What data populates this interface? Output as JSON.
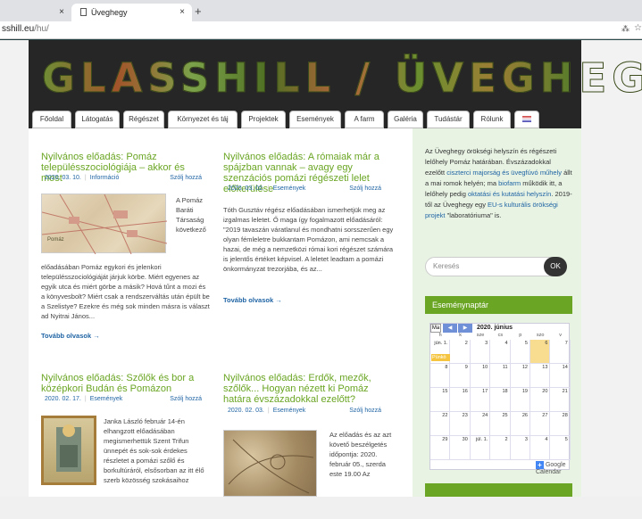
{
  "browser": {
    "tab1_close": "×",
    "tab2_title": "Üveghegy",
    "tab2_close": "×",
    "new_tab": "+",
    "url_host": "sshill.eu",
    "url_path": "/hu/",
    "translate_icon": "translate-icon",
    "star_icon": "star-icon"
  },
  "site": {
    "logo": "GLASSHILL / ÜVEGHEGY",
    "nav": [
      "Főoldal",
      "Látogatás",
      "Régészet",
      "Környezet és táj",
      "Projektek",
      "Események",
      "A farm",
      "Galéria",
      "Tudástár",
      "Rólunk"
    ],
    "nav_flag": "uk-flag-icon"
  },
  "posts": [
    {
      "title": "Nyilvános előadás: Pomáz településszociológiája – akkor és most",
      "date": "2020. 03. 10.",
      "category": "Információ",
      "reply": "Szólj hozzá",
      "side_text": "A Pomáz Baráti Társaság következő",
      "body": "előadásában Pomáz egykori és jelenkori településszociológiáját járjuk körbe. Miért egyenes az egyik utca és miért görbe a másik? Hová tűnt a mozi és a könyvesbolt? Miért csak a rendszerváltás után épült be a Szelistye? Ezekre és még sok minden másra is választ ad Nyitrai János...",
      "more": "Tovább olvasok →",
      "map_label": "Pomáz"
    },
    {
      "title": "Nyilvános előadás: A rómaiak már a spájzban vannak – avagy egy szenzációs pomázi régészeti lelet előkerülése",
      "date": "2020. 03. 02.",
      "category": "Események",
      "reply": "Szólj hozzá",
      "body": "Tóth Gusztáv régész előadásában ismerhetjük meg az izgalmas leletet. Ő maga így fogalmazott előadásáról: \"2019 tavaszán váratlanul és mondhatni sorsszerűen egy olyan fémleletre bukkantam Pomázon, ami nemcsak a hazai, de még a nemzetközi római kori régészet számára is jelentős értéket képvisel. A leletet leadtam a pomázi önkormányzat trezorjába, és az...",
      "more": "Tovább olvasok →"
    },
    {
      "title": "Nyilvános előadás: Szőlők és bor a középkori Budán és Pomázon",
      "date": "2020. 02. 17.",
      "category": "Események",
      "reply": "Szólj hozzá",
      "side_text": "Janka László február 14-én elhangzott előadásában megismerhettük Szent Trifun ünnepét és sok-sok érdekes részletet a pomázi szőlő és borkultúráról, elsősorban az itt élő szerb közösség szokásaihoz"
    },
    {
      "title": "Nyilvános előadás: Erdők, mezők, szőlők... Hogyan nézett ki Pomáz határa évszázadokkal ezelőtt?",
      "date": "2020. 02. 03.",
      "category": "Események",
      "reply": "Szólj hozzá",
      "side_text": "Az előadás és az azt követő beszélgetés időpontja: 2020. február 05., szerda este 19.00 Az"
    }
  ],
  "sidebar": {
    "intro_1": "Az Üveghegy örökségi helyszín és régészeti lelőhely Pomáz határában. Évszázadokkal ezelőtt ",
    "intro_link1": "ciszterci majorság és üvegfúvó műhely",
    "intro_2": " állt a mai romok helyén; ma ",
    "intro_link2": "biofarm",
    "intro_3": " működik itt, a lelőhely pedig ",
    "intro_link3": "oktatási és kutatási helyszín",
    "intro_4": ". 2019-től az Üveghegy egy ",
    "intro_link4": "EU-s kulturális örökségi projekt",
    "intro_5": " \"laboratóriuma\" is.",
    "search_placeholder": "Keresés",
    "ok": "OK",
    "events_heading": "Eseménynaptár",
    "calendar": {
      "view_btn": "Ma",
      "prev": "◀",
      "next": "▶",
      "month": "2020. június",
      "weekdays": [
        "h",
        "k",
        "sze",
        "cs",
        "p",
        "szo",
        "v"
      ],
      "weeks": [
        [
          "jún. 1.",
          "2",
          "3",
          "4",
          "5",
          "6",
          "7"
        ],
        [
          "8",
          "9",
          "10",
          "11",
          "12",
          "13",
          "14"
        ],
        [
          "15",
          "16",
          "17",
          "18",
          "19",
          "20",
          "21"
        ],
        [
          "22",
          "23",
          "24",
          "25",
          "26",
          "27",
          "28"
        ],
        [
          "29",
          "30",
          "júl. 1.",
          "2",
          "3",
          "4",
          "5"
        ]
      ],
      "event": "Pünkö",
      "google": "Google Calendar",
      "google_plus": "+"
    }
  }
}
